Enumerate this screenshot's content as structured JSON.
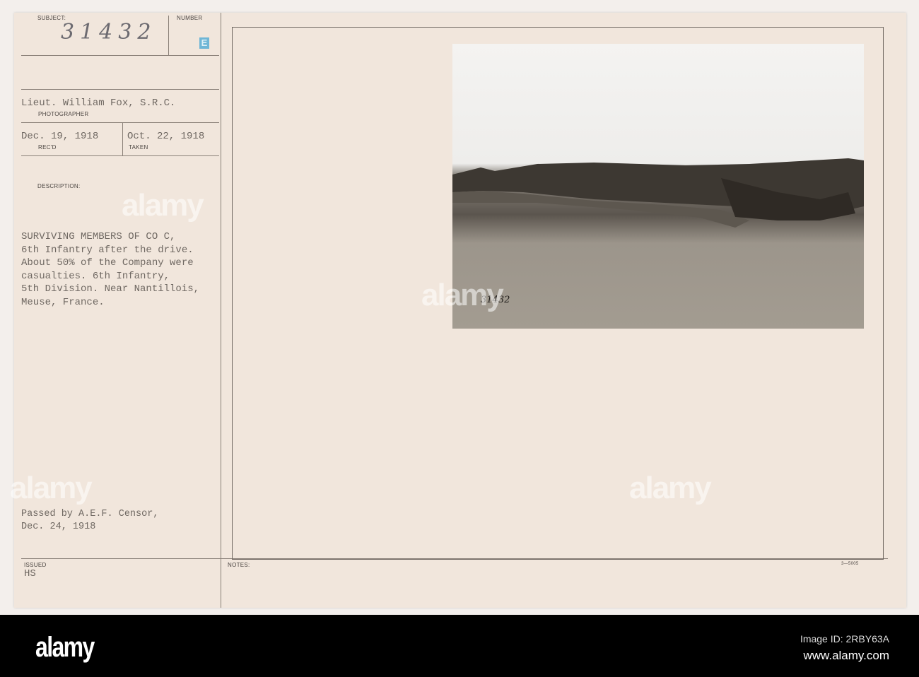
{
  "card": {
    "subject_label": "SUBJECT:",
    "number_label": "NUMBER",
    "subject_number": "31432",
    "number_stamp": "E",
    "photographer": "Lieut. William Fox, S.R.C.",
    "photographer_label": "PHOTOGRAPHER",
    "received_date": "Dec. 19, 1918",
    "received_label": "REC'D",
    "taken_date": "Oct. 22, 1918",
    "taken_label": "TAKEN",
    "description_label": "DESCRIPTION:",
    "description": "SURVIVING MEMBERS OF CO C,\n6th Infantry after the drive.\nAbout 50% of the Company were\ncasualties. 6th Infantry,\n5th Division. Near Nantillois,\nMeuse, France.",
    "censor": "Passed by A.E.F. Censor,\nDec. 24, 1918",
    "issued_label": "ISSUED",
    "issued_value": "HS",
    "notes_label": "NOTES:",
    "form_code": "3—5005",
    "photo_number": "31432"
  },
  "watermark": "alamy",
  "footer": {
    "logo": "alamy",
    "image_id": "Image ID: 2RBY63A",
    "site": "www.alamy.com"
  }
}
